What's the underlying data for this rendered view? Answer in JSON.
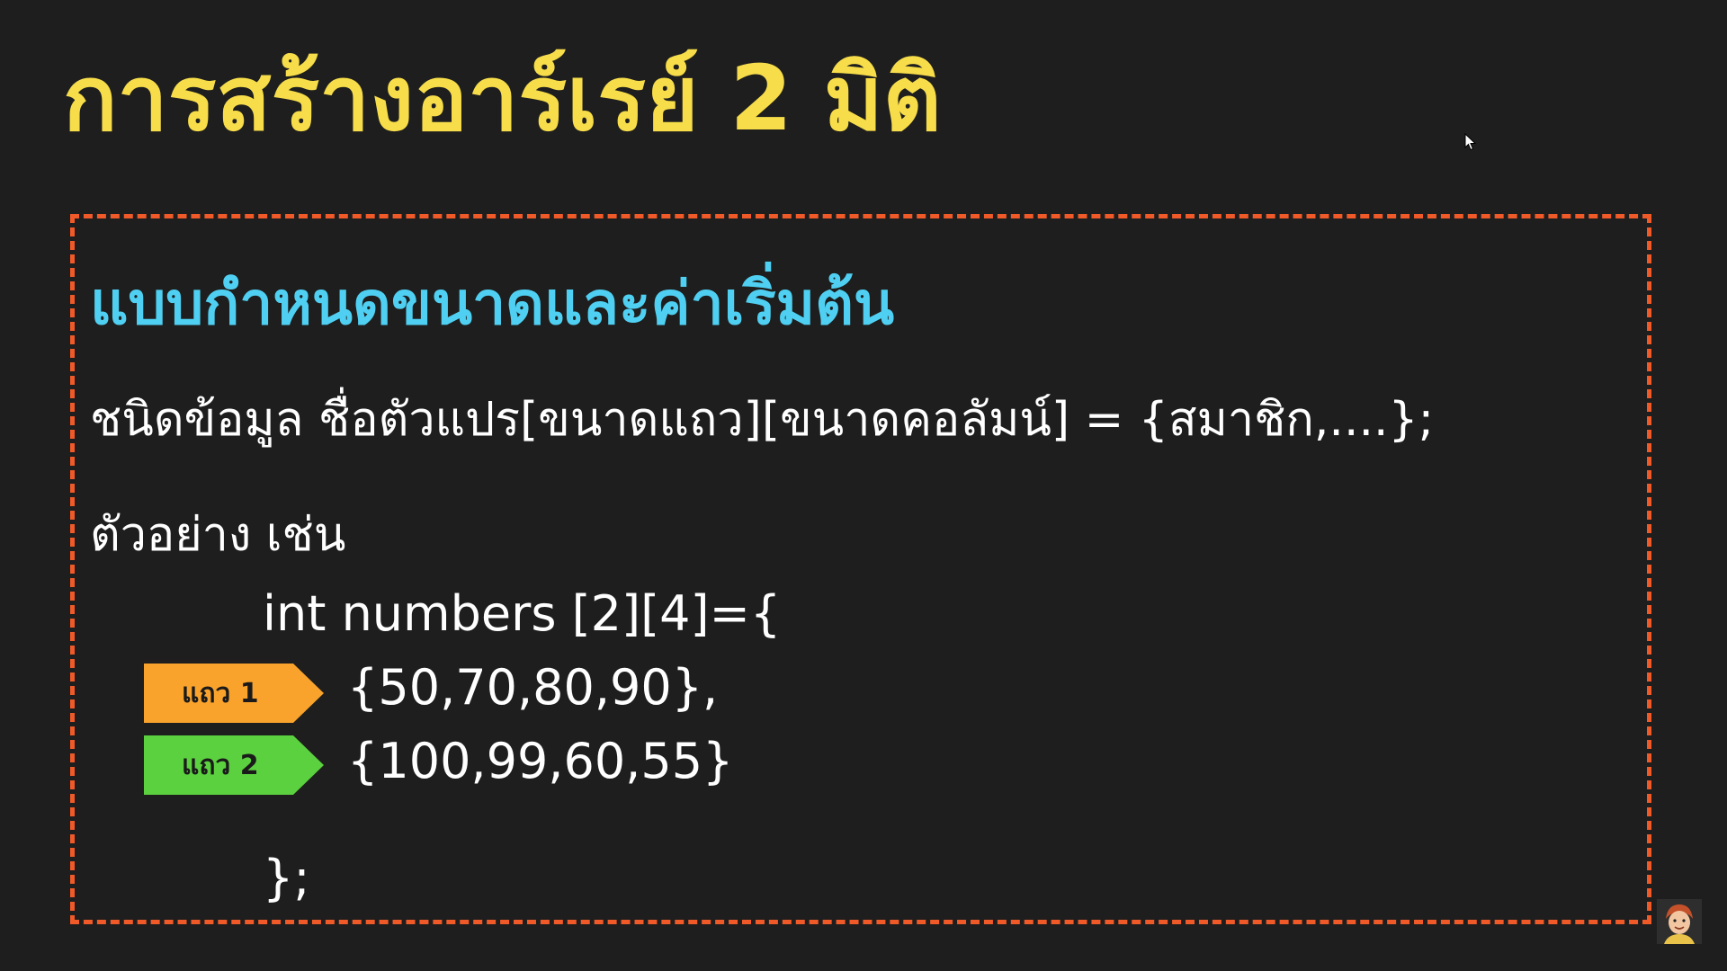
{
  "slide": {
    "title": "การสร้างอาร์เรย์ 2 มิติ",
    "heading": "แบบกำหนดขนาดและค่าเริ่มต้น",
    "syntax": "ชนิดข้อมูล ชื่อตัวแปร[ขนาดแถว][ขนาดคอลัมน์] = {สมาชิก,....};",
    "example_label": "ตัวอย่าง เช่น",
    "code": {
      "declaration": "int numbers [2][4]={",
      "row1": "{50,70,80,90},",
      "row2": "{100,99,60,55}",
      "closing": "};"
    },
    "row_tags": [
      {
        "label": "แถว 1",
        "color": "#f9a32c"
      },
      {
        "label": "แถว 2",
        "color": "#5bd13f"
      }
    ]
  },
  "colors": {
    "background": "#1e1e1e",
    "title": "#f7dd4a",
    "heading": "#4fd0f2",
    "border": "#f05a28",
    "text": "#ffffff"
  },
  "icons": {
    "cursor": "mouse-pointer-icon",
    "avatar": "presenter-avatar-icon"
  }
}
